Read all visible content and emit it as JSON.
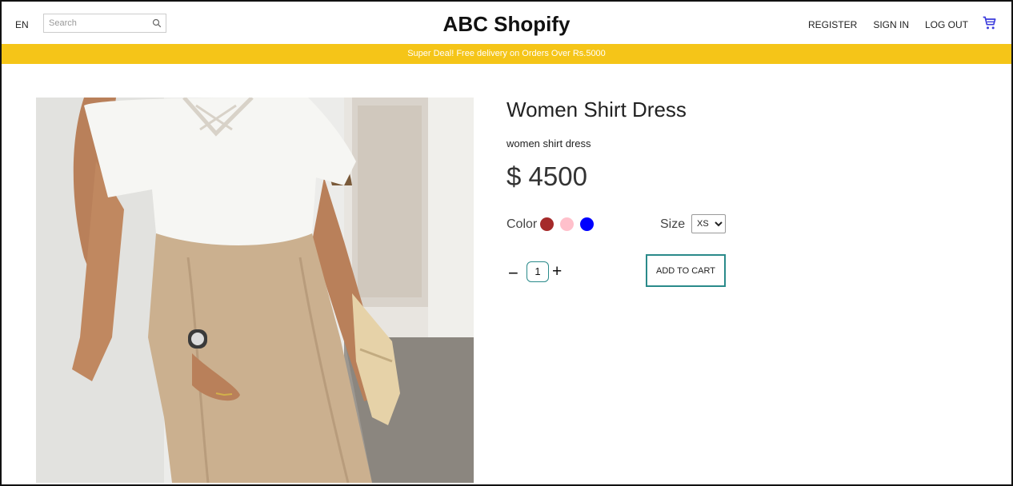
{
  "header": {
    "language": "EN",
    "search_placeholder": "Search",
    "brand": "ABC Shopify",
    "nav": {
      "register": "REGISTER",
      "sign_in": "SIGN IN",
      "log_out": "LOG OUT"
    },
    "cart_icon": "shopping-cart-icon",
    "accent_color": "#3b3bdc"
  },
  "promo": {
    "text": "Super Deal! Free delivery on Orders Over Rs.5000",
    "bg_color": "#f5c518"
  },
  "product": {
    "title": "Women Shirt Dress",
    "description": "women shirt dress",
    "price": "$ 4500",
    "color_label": "Color",
    "colors": [
      "#a52a2a",
      "#ffc0cb",
      "#0000ff"
    ],
    "size_label": "Size",
    "size_selected": "XS",
    "quantity": "1",
    "add_to_cart": "ADD TO CART"
  }
}
